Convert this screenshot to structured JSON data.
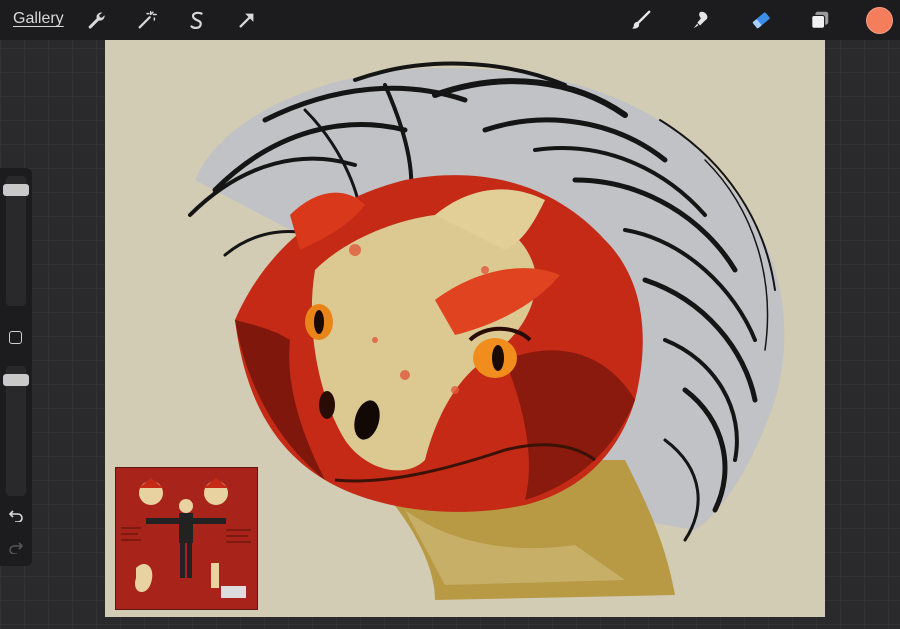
{
  "toolbar": {
    "gallery_label": "Gallery",
    "left_tools": [
      {
        "icon": "wrench-icon"
      },
      {
        "icon": "magic-wand-icon"
      },
      {
        "icon": "selection-s-icon"
      },
      {
        "icon": "transform-arrow-icon"
      }
    ],
    "right_tools": [
      {
        "icon": "brush-icon"
      },
      {
        "icon": "smudge-icon"
      },
      {
        "icon": "eraser-icon"
      },
      {
        "icon": "layers-icon"
      }
    ],
    "active_tool": "eraser",
    "current_color": "#f47d5c",
    "accent_color": "#3d8ee8"
  },
  "sidebar": {
    "brush_size": 0.93,
    "opacity": 0.93
  },
  "canvas": {
    "background_color": "#d3ccb4"
  }
}
